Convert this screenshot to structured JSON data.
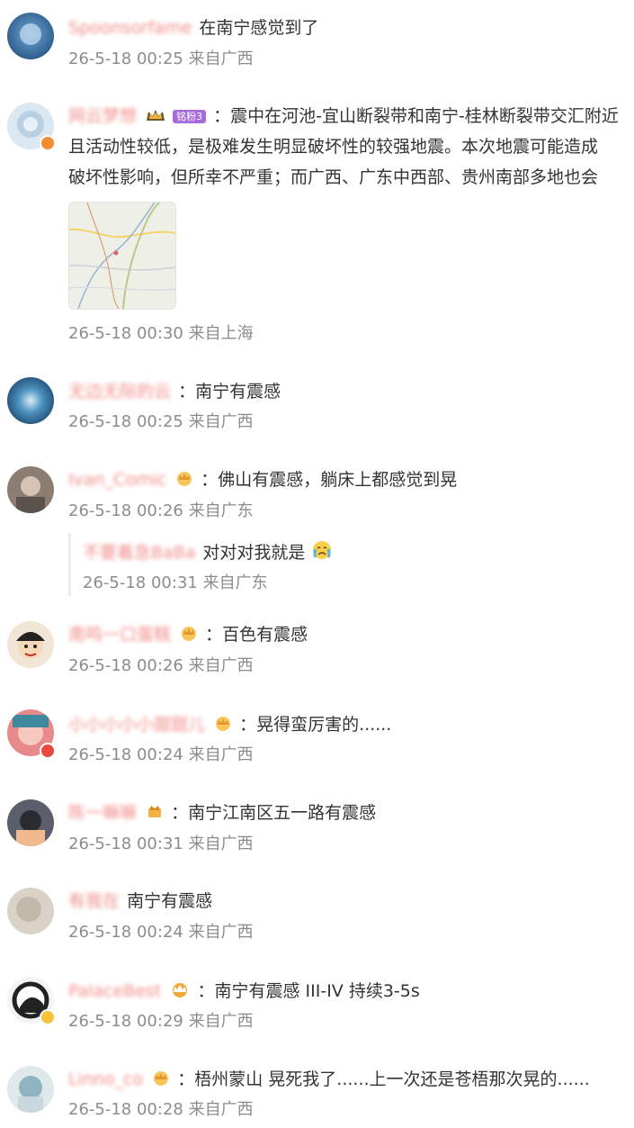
{
  "comments": [
    {
      "user": "Spoonsorfame",
      "badge": "",
      "text": "在南宁感觉到了",
      "time": "26-5-18 00:25",
      "loc": "来自广西"
    },
    {
      "user": "网云梦想",
      "badge": "铭粉3",
      "text": "：震中在河池-宜山断裂带和南宁-桂林断裂带交汇附近",
      "cont1": "且活动性较低，是极难发生明显破坏性的较强地震。本次地震可能造成",
      "cont2": "破坏性影响，但所幸不严重；而广西、广东中西部、贵州南部多地也会",
      "time": "26-5-18 00:30",
      "loc": "来自上海"
    },
    {
      "user": "无边无际的云",
      "badge": "",
      "text": "：南宁有震感",
      "time": "26-5-18 00:25",
      "loc": "来自广西"
    },
    {
      "user": "Ivan_Comic",
      "badge": "",
      "text": "：佛山有震感，躺床上都感觉到晃",
      "time": "26-5-18 00:26",
      "loc": "来自广东"
    },
    {
      "user": "南鸣一口蛋糕",
      "badge": "",
      "text": "：百色有震感",
      "time": "26-5-18 00:26",
      "loc": "来自广西"
    },
    {
      "user": "小小小小小甜甜儿",
      "badge": "",
      "text": "：晃得蛮厉害的......",
      "time": "26-5-18 00:24",
      "loc": "来自广西"
    },
    {
      "user": "陈一嘛嘛",
      "badge": "",
      "text": "：南宁江南区五一路有震感",
      "time": "26-5-18 00:31",
      "loc": "来自广西"
    },
    {
      "user": "有我在",
      "badge": "",
      "text": "南宁有震感",
      "time": "26-5-18 00:24",
      "loc": "来自广西"
    },
    {
      "user": "PalaceBest",
      "badge": "",
      "text": "：南宁有震感 III-IV 持续3-5s",
      "time": "26-5-18 00:29",
      "loc": "来自广西"
    },
    {
      "user": "Linno_co",
      "badge": "",
      "text": "：梧州蒙山 晃死我了......上一次还是苍梧那次晃的......",
      "time": "26-5-18 00:28",
      "loc": "来自广西"
    }
  ],
  "reply": {
    "user": "不要着急BaBa",
    "text": "对对对我就是",
    "time": "26-5-18 00:31",
    "loc": "来自广东"
  },
  "icons": {
    "crown": "crown-icon",
    "crying_emoji": "crying-face-emoji",
    "verified": "verified-badge-icon"
  },
  "colors": {
    "username": "#f08a86",
    "meta": "#8c8c8c",
    "text": "#333333",
    "fan_badge": "#a56bdd"
  }
}
